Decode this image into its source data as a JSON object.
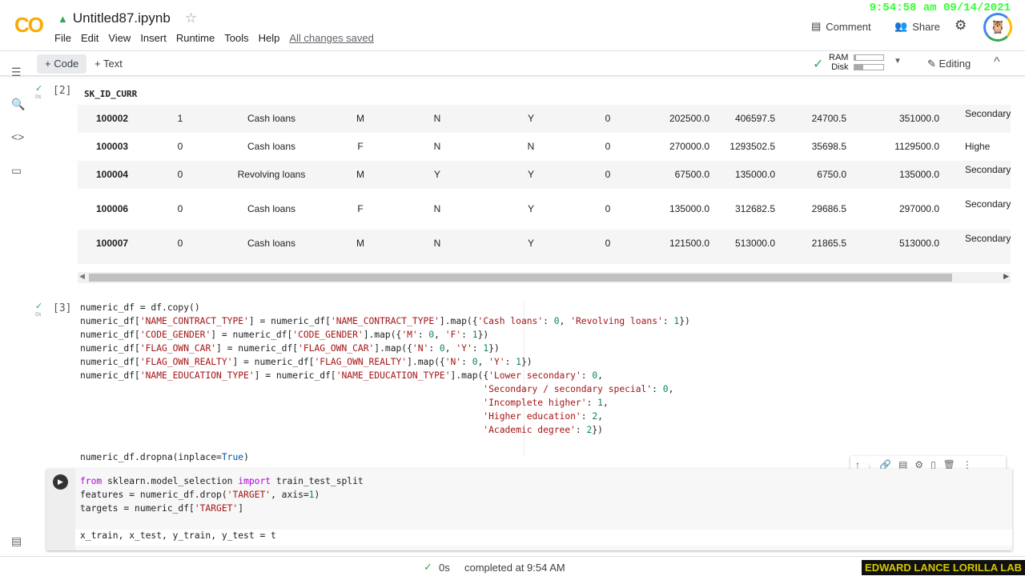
{
  "clock": "9:54:58 am 09/14/2021",
  "header": {
    "logo": "CO",
    "title": "Untitled87.ipynb",
    "menu": [
      "File",
      "Edit",
      "View",
      "Insert",
      "Runtime",
      "Tools",
      "Help"
    ],
    "saved": "All changes saved",
    "comment": "Comment",
    "share": "Share"
  },
  "toolbar": {
    "code": "+ Code",
    "text": "+ Text",
    "ram": "RAM",
    "disk": "Disk",
    "ram_fraction": 0.05,
    "disk_fraction": 0.3,
    "editing": "Editing"
  },
  "cell2": {
    "exec": "[2]",
    "time": "0s",
    "index_header": "SK_ID_CURR",
    "rows": [
      [
        "100002",
        "1",
        "Cash loans",
        "M",
        "N",
        "Y",
        "0",
        "202500.0",
        "406597.5",
        "24700.5",
        "351000.0",
        "Secondary /"
      ],
      [
        "100003",
        "0",
        "Cash loans",
        "F",
        "N",
        "N",
        "0",
        "270000.0",
        "1293502.5",
        "35698.5",
        "1129500.0",
        "Highe"
      ],
      [
        "100004",
        "0",
        "Revolving loans",
        "M",
        "Y",
        "Y",
        "0",
        "67500.0",
        "135000.0",
        "6750.0",
        "135000.0",
        "Secondary /"
      ],
      [
        "100006",
        "0",
        "Cash loans",
        "F",
        "N",
        "Y",
        "0",
        "135000.0",
        "312682.5",
        "29686.5",
        "297000.0",
        "Secondary /"
      ],
      [
        "100007",
        "0",
        "Cash loans",
        "M",
        "N",
        "Y",
        "0",
        "121500.0",
        "513000.0",
        "21865.5",
        "513000.0",
        "Secondary /"
      ]
    ]
  },
  "cell3": {
    "exec": "[3]",
    "time": "0s",
    "lines": [
      "numeric_df = df.copy()",
      "numeric_df['NAME_CONTRACT_TYPE'] = numeric_df['NAME_CONTRACT_TYPE'].map({'Cash loans': 0, 'Revolving loans': 1})",
      "numeric_df['CODE_GENDER'] = numeric_df['CODE_GENDER'].map({'M': 0, 'F': 1})",
      "numeric_df['FLAG_OWN_CAR'] = numeric_df['FLAG_OWN_CAR'].map({'N': 0, 'Y': 1})",
      "numeric_df['FLAG_OWN_REALTY'] = numeric_df['FLAG_OWN_REALTY'].map({'N': 0, 'Y': 1})",
      "numeric_df['NAME_EDUCATION_TYPE'] = numeric_df['NAME_EDUCATION_TYPE'].map({'Lower secondary': 0,",
      "                                                                          'Secondary / secondary special': 0,",
      "                                                                          'Incomplete higher': 1,",
      "                                                                          'Higher education': 2,",
      "                                                                          'Academic degree': 2})",
      "",
      "numeric_df.dropna(inplace=True)"
    ]
  },
  "cell4": {
    "lines": [
      "from sklearn.model_selection import train_test_split",
      "features = numeric_df.drop('TARGET', axis=1)",
      "targets = numeric_df['TARGET']",
      "",
      "x_train, x_test, y_train, y_test = t"
    ]
  },
  "status": {
    "time": "0s",
    "text": "completed at 9:54 AM"
  },
  "watermark": "EDWARD LANCE LORILLA LAB"
}
